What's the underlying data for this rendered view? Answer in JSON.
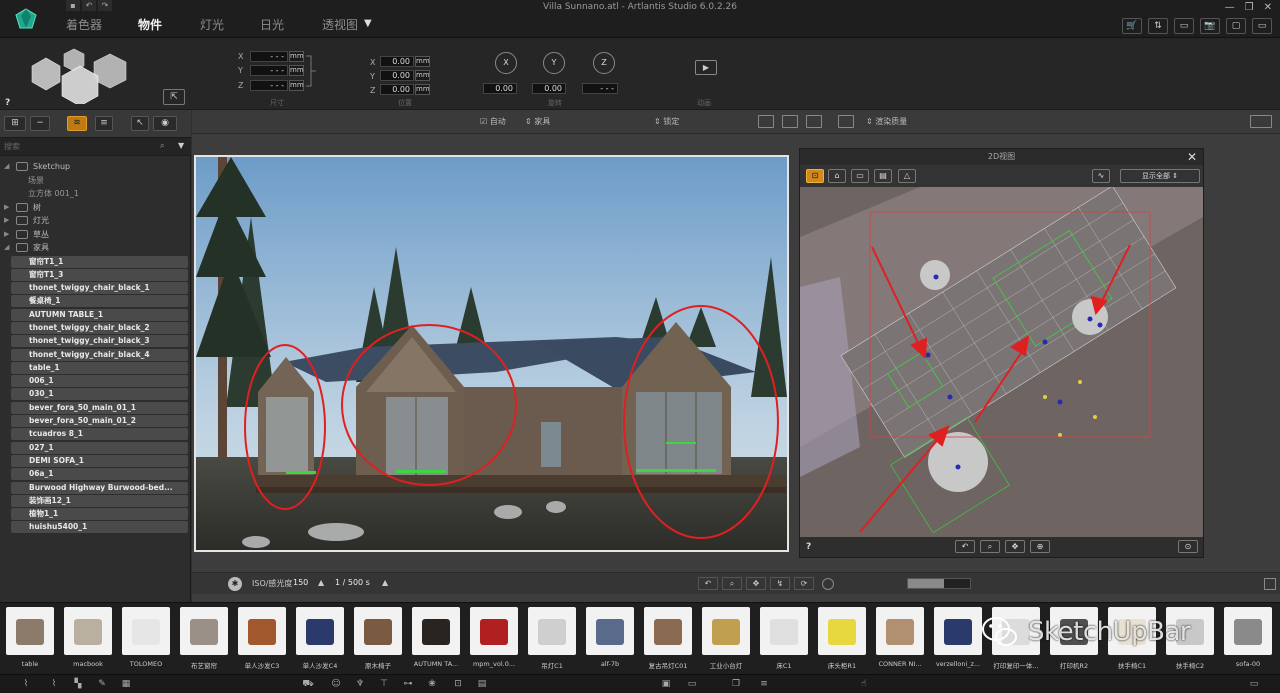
{
  "window": {
    "title": "Villa Sunnano.atl - Artlantis Studio 6.0.2.26",
    "controls": [
      "—",
      "❐",
      "✕"
    ]
  },
  "quick_access": [
    "▪",
    "↶",
    "↷"
  ],
  "tabs": [
    {
      "label": "着色器"
    },
    {
      "label": "物件"
    },
    {
      "label": "灯光"
    },
    {
      "label": "日光"
    },
    {
      "label": "透视图"
    }
  ],
  "tab_dropdown": "▼",
  "right_toolbar": [
    "🛒",
    "⇅",
    "▭",
    "📷",
    "▢",
    "▭"
  ],
  "inspector": {
    "help": "?",
    "position": {
      "x_value": "- - -",
      "y_value": "- - -",
      "z_value": "- - -",
      "unit": "mm",
      "group_label": "尺寸"
    },
    "location": {
      "x_value": "0.00",
      "y_value": "0.00",
      "z_value": "0.00",
      "unit": "mm",
      "group_label": "位置"
    },
    "rotation": {
      "x_value": "0.00",
      "y_value": "0.00",
      "z_value": "- - -",
      "group_label": "旋转"
    },
    "camera_group_label": "动画",
    "axis_x": "X",
    "axis_y": "Y",
    "axis_z": "Z"
  },
  "leftpanel": {
    "search_placeholder": "搜索",
    "tree": [
      {
        "label": "Sketchup",
        "arrow": "◢",
        "type": "node"
      },
      {
        "label": "场景",
        "type": "sub"
      },
      {
        "label": "立方体 001_1",
        "type": "sub"
      },
      {
        "label": "树",
        "arrow": "▶",
        "type": "node"
      },
      {
        "label": "灯光",
        "arrow": "▶",
        "type": "node"
      },
      {
        "label": "草丛",
        "arrow": "▶",
        "type": "node"
      },
      {
        "label": "家具",
        "arrow": "◢",
        "type": "node"
      }
    ],
    "items": [
      "窗帘T1_1",
      "窗帘T1_3",
      "thonet_twiggy_chair_black_1",
      "餐桌椅_1",
      "AUTUMN TABLE_1",
      "thonet_twiggy_chair_black_2",
      "thonet_twiggy_chair_black_3",
      "thonet_twiggy_chair_black_4",
      "table_1",
      "006_1",
      "030_1",
      "bever_fora_50_main_01_1",
      "bever_fora_50_main_01_2",
      "tcuadros 8_1",
      "027_1",
      "DEMI SOFA_1",
      "06a_1",
      "Burwood Highway Burwood-bed...",
      "装饰画12_1",
      "植物1_1",
      "huishu5400_1"
    ]
  },
  "viewport": {
    "auto_label": "自动",
    "furniture_label": "家具",
    "lock_label": "锁定",
    "display_label": "渲染质量",
    "iso_label": "ISO/感光度",
    "iso_value": "150",
    "shutter_value": "1 / 500 s",
    "help": "?"
  },
  "plan2d": {
    "title": "2D视图",
    "close": "✕",
    "display_select": "显示全部",
    "help": "?"
  },
  "catalog": [
    {
      "label": "table",
      "icon": "table-thumb"
    },
    {
      "label": "macbook",
      "icon": "laptop-thumb"
    },
    {
      "label": "TOLOMEO",
      "icon": "lamp-thumb"
    },
    {
      "label": "布艺窗帘",
      "icon": "curtain-thumb"
    },
    {
      "label": "单人沙发C3",
      "icon": "armchair-thumb"
    },
    {
      "label": "单人沙发C4",
      "icon": "armchair-blue-thumb"
    },
    {
      "label": "原木椅子",
      "icon": "chair-thumb"
    },
    {
      "label": "AUTUMN TA...",
      "icon": "table-dark-thumb"
    },
    {
      "label": "mpm_vol.0...",
      "icon": "bottle-thumb"
    },
    {
      "label": "吊灯C1",
      "icon": "pendant-thumb"
    },
    {
      "label": "alf-7b",
      "icon": "rug-thumb"
    },
    {
      "label": "复古吊灯C01",
      "icon": "chandelier-thumb"
    },
    {
      "label": "工业小台灯",
      "icon": "wall-lamp-thumb"
    },
    {
      "label": "床C1",
      "icon": "bed-thumb"
    },
    {
      "label": "床头柜R1",
      "icon": "nightstand-thumb"
    },
    {
      "label": "CONNER NI...",
      "icon": "cabinet-thumb"
    },
    {
      "label": "verzelloni_z...",
      "icon": "sofa-blue-thumb"
    },
    {
      "label": "打印复印一体...",
      "icon": "printer-thumb"
    },
    {
      "label": "打印机R2",
      "icon": "printer2-thumb"
    },
    {
      "label": "扶手椅C1",
      "icon": "armchair2-thumb"
    },
    {
      "label": "扶手椅C2",
      "icon": "armchair3-thumb"
    },
    {
      "label": "sofa-00",
      "icon": "sofa-thumb"
    }
  ],
  "watermark": "SketchUpBar",
  "colors": {
    "accent": "#d08a1a",
    "annotation": "#e02020"
  }
}
